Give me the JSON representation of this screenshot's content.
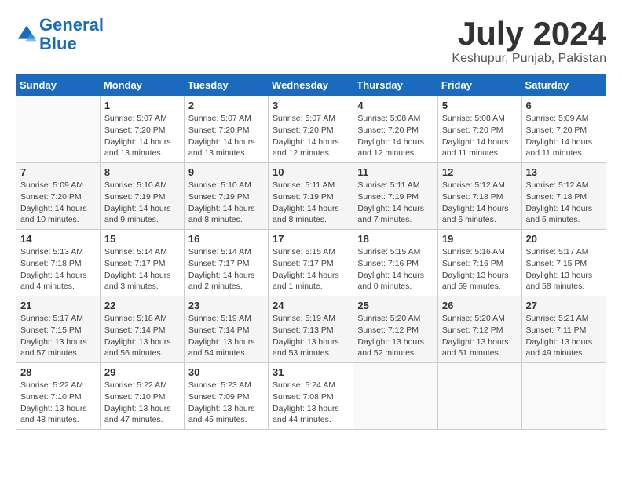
{
  "logo": {
    "text_general": "General",
    "text_blue": "Blue"
  },
  "title": "July 2024",
  "subtitle": "Keshupur, Punjab, Pakistan",
  "days_of_week": [
    "Sunday",
    "Monday",
    "Tuesday",
    "Wednesday",
    "Thursday",
    "Friday",
    "Saturday"
  ],
  "weeks": [
    [
      {
        "day": "",
        "info": ""
      },
      {
        "day": "1",
        "info": "Sunrise: 5:07 AM\nSunset: 7:20 PM\nDaylight: 14 hours\nand 13 minutes."
      },
      {
        "day": "2",
        "info": "Sunrise: 5:07 AM\nSunset: 7:20 PM\nDaylight: 14 hours\nand 13 minutes."
      },
      {
        "day": "3",
        "info": "Sunrise: 5:07 AM\nSunset: 7:20 PM\nDaylight: 14 hours\nand 12 minutes."
      },
      {
        "day": "4",
        "info": "Sunrise: 5:08 AM\nSunset: 7:20 PM\nDaylight: 14 hours\nand 12 minutes."
      },
      {
        "day": "5",
        "info": "Sunrise: 5:08 AM\nSunset: 7:20 PM\nDaylight: 14 hours\nand 11 minutes."
      },
      {
        "day": "6",
        "info": "Sunrise: 5:09 AM\nSunset: 7:20 PM\nDaylight: 14 hours\nand 11 minutes."
      }
    ],
    [
      {
        "day": "7",
        "info": "Sunrise: 5:09 AM\nSunset: 7:20 PM\nDaylight: 14 hours\nand 10 minutes."
      },
      {
        "day": "8",
        "info": "Sunrise: 5:10 AM\nSunset: 7:19 PM\nDaylight: 14 hours\nand 9 minutes."
      },
      {
        "day": "9",
        "info": "Sunrise: 5:10 AM\nSunset: 7:19 PM\nDaylight: 14 hours\nand 8 minutes."
      },
      {
        "day": "10",
        "info": "Sunrise: 5:11 AM\nSunset: 7:19 PM\nDaylight: 14 hours\nand 8 minutes."
      },
      {
        "day": "11",
        "info": "Sunrise: 5:11 AM\nSunset: 7:19 PM\nDaylight: 14 hours\nand 7 minutes."
      },
      {
        "day": "12",
        "info": "Sunrise: 5:12 AM\nSunset: 7:18 PM\nDaylight: 14 hours\nand 6 minutes."
      },
      {
        "day": "13",
        "info": "Sunrise: 5:12 AM\nSunset: 7:18 PM\nDaylight: 14 hours\nand 5 minutes."
      }
    ],
    [
      {
        "day": "14",
        "info": "Sunrise: 5:13 AM\nSunset: 7:18 PM\nDaylight: 14 hours\nand 4 minutes."
      },
      {
        "day": "15",
        "info": "Sunrise: 5:14 AM\nSunset: 7:17 PM\nDaylight: 14 hours\nand 3 minutes."
      },
      {
        "day": "16",
        "info": "Sunrise: 5:14 AM\nSunset: 7:17 PM\nDaylight: 14 hours\nand 2 minutes."
      },
      {
        "day": "17",
        "info": "Sunrise: 5:15 AM\nSunset: 7:17 PM\nDaylight: 14 hours\nand 1 minute."
      },
      {
        "day": "18",
        "info": "Sunrise: 5:15 AM\nSunset: 7:16 PM\nDaylight: 14 hours\nand 0 minutes."
      },
      {
        "day": "19",
        "info": "Sunrise: 5:16 AM\nSunset: 7:16 PM\nDaylight: 13 hours\nand 59 minutes."
      },
      {
        "day": "20",
        "info": "Sunrise: 5:17 AM\nSunset: 7:15 PM\nDaylight: 13 hours\nand 58 minutes."
      }
    ],
    [
      {
        "day": "21",
        "info": "Sunrise: 5:17 AM\nSunset: 7:15 PM\nDaylight: 13 hours\nand 57 minutes."
      },
      {
        "day": "22",
        "info": "Sunrise: 5:18 AM\nSunset: 7:14 PM\nDaylight: 13 hours\nand 56 minutes."
      },
      {
        "day": "23",
        "info": "Sunrise: 5:19 AM\nSunset: 7:14 PM\nDaylight: 13 hours\nand 54 minutes."
      },
      {
        "day": "24",
        "info": "Sunrise: 5:19 AM\nSunset: 7:13 PM\nDaylight: 13 hours\nand 53 minutes."
      },
      {
        "day": "25",
        "info": "Sunrise: 5:20 AM\nSunset: 7:12 PM\nDaylight: 13 hours\nand 52 minutes."
      },
      {
        "day": "26",
        "info": "Sunrise: 5:20 AM\nSunset: 7:12 PM\nDaylight: 13 hours\nand 51 minutes."
      },
      {
        "day": "27",
        "info": "Sunrise: 5:21 AM\nSunset: 7:11 PM\nDaylight: 13 hours\nand 49 minutes."
      }
    ],
    [
      {
        "day": "28",
        "info": "Sunrise: 5:22 AM\nSunset: 7:10 PM\nDaylight: 13 hours\nand 48 minutes."
      },
      {
        "day": "29",
        "info": "Sunrise: 5:22 AM\nSunset: 7:10 PM\nDaylight: 13 hours\nand 47 minutes."
      },
      {
        "day": "30",
        "info": "Sunrise: 5:23 AM\nSunset: 7:09 PM\nDaylight: 13 hours\nand 45 minutes."
      },
      {
        "day": "31",
        "info": "Sunrise: 5:24 AM\nSunset: 7:08 PM\nDaylight: 13 hours\nand 44 minutes."
      },
      {
        "day": "",
        "info": ""
      },
      {
        "day": "",
        "info": ""
      },
      {
        "day": "",
        "info": ""
      }
    ]
  ]
}
